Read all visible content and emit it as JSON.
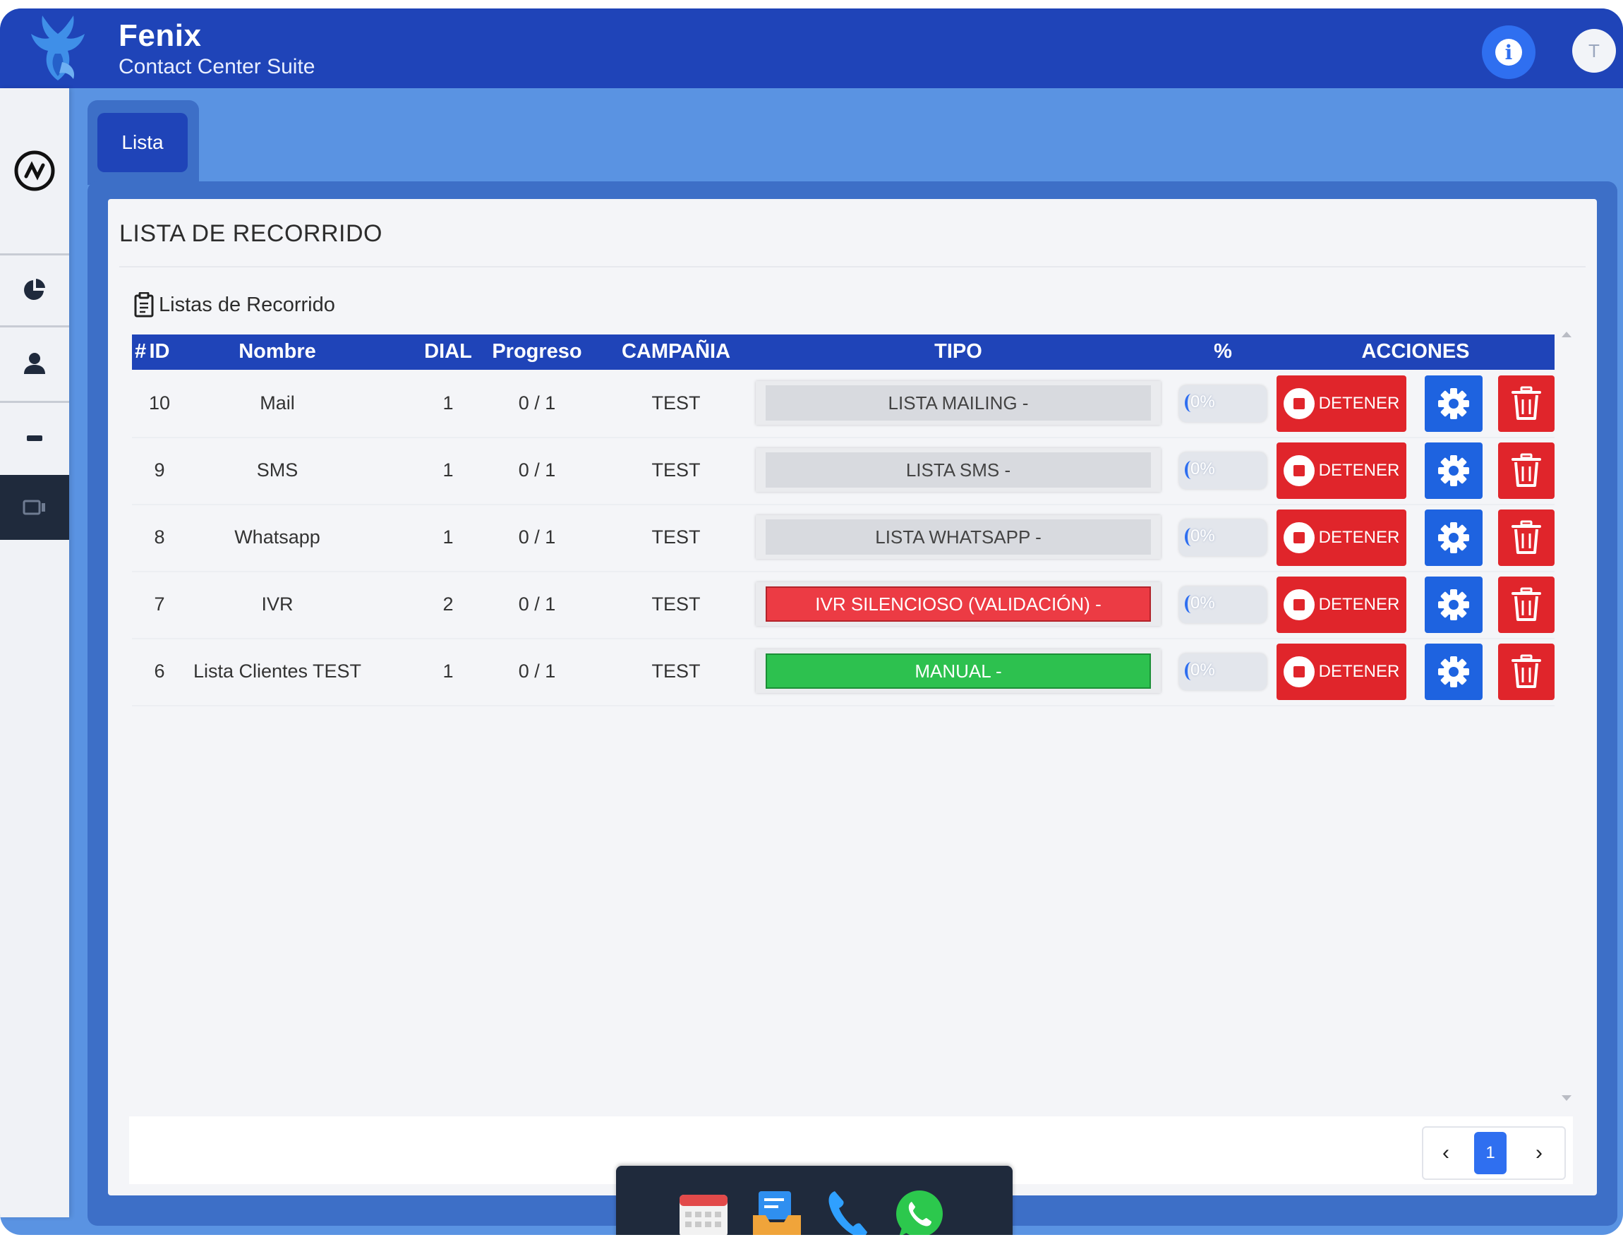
{
  "header": {
    "title": "Fenix",
    "subtitle": "Contact Center Suite",
    "avatar_initial": "T",
    "info_icon": "info-icon"
  },
  "sidebar": {
    "items": [
      {
        "icon": "brand-circle-icon"
      },
      {
        "icon": "pie-chart-icon"
      },
      {
        "icon": "user-icon"
      },
      {
        "icon": "minus-bar-icon"
      },
      {
        "icon": "list-device-icon",
        "active": true
      }
    ]
  },
  "tabs": [
    {
      "label": "Lista",
      "active": true
    }
  ],
  "panel": {
    "title": "LISTA DE RECORRIDO",
    "section_label": "Listas de Recorrido"
  },
  "table": {
    "columns": [
      "#",
      "ID",
      "Nombre",
      "DIAL",
      "Progreso",
      "CAMPAÑIA",
      "TIPO",
      "%",
      "ACCIONES"
    ],
    "rows": [
      {
        "id": "10",
        "nombre": "Mail",
        "dial": "1",
        "progreso": "0 / 1",
        "campania": "TEST",
        "tipo": "LISTA MAILING -",
        "tipo_style": "gray",
        "pct": "0%",
        "pct_value": 0,
        "stop_label": "DETENER"
      },
      {
        "id": "9",
        "nombre": "SMS",
        "dial": "1",
        "progreso": "0 / 1",
        "campania": "TEST",
        "tipo": "LISTA SMS -",
        "tipo_style": "gray",
        "pct": "0%",
        "pct_value": 0,
        "stop_label": "DETENER"
      },
      {
        "id": "8",
        "nombre": "Whatsapp",
        "dial": "1",
        "progreso": "0 / 1",
        "campania": "TEST",
        "tipo": "LISTA WHATSAPP -",
        "tipo_style": "gray",
        "pct": "0%",
        "pct_value": 0,
        "stop_label": "DETENER"
      },
      {
        "id": "7",
        "nombre": "IVR",
        "dial": "2",
        "progreso": "0 / 1",
        "campania": "TEST",
        "tipo": "IVR SILENCIOSO (VALIDACIÓN) -",
        "tipo_style": "red",
        "pct": "0%",
        "pct_value": 0,
        "stop_label": "DETENER"
      },
      {
        "id": "6",
        "nombre": "Lista Clientes TEST",
        "dial": "1",
        "progreso": "0 / 1",
        "campania": "TEST",
        "tipo": "MANUAL -",
        "tipo_style": "green",
        "pct": "0%",
        "pct_value": 0,
        "stop_label": "DETENER"
      }
    ]
  },
  "pagination": {
    "prev": "‹",
    "current": "1",
    "next": "›"
  },
  "dock": {
    "items": [
      {
        "icon": "calendar-icon"
      },
      {
        "icon": "mail-inbox-icon"
      },
      {
        "icon": "phone-icon"
      },
      {
        "icon": "whatsapp-icon"
      }
    ]
  },
  "colors": {
    "header": "#1f44b8",
    "accent_blue": "#2f6ff0",
    "danger": "#e0252b",
    "success": "#2dc14f"
  }
}
